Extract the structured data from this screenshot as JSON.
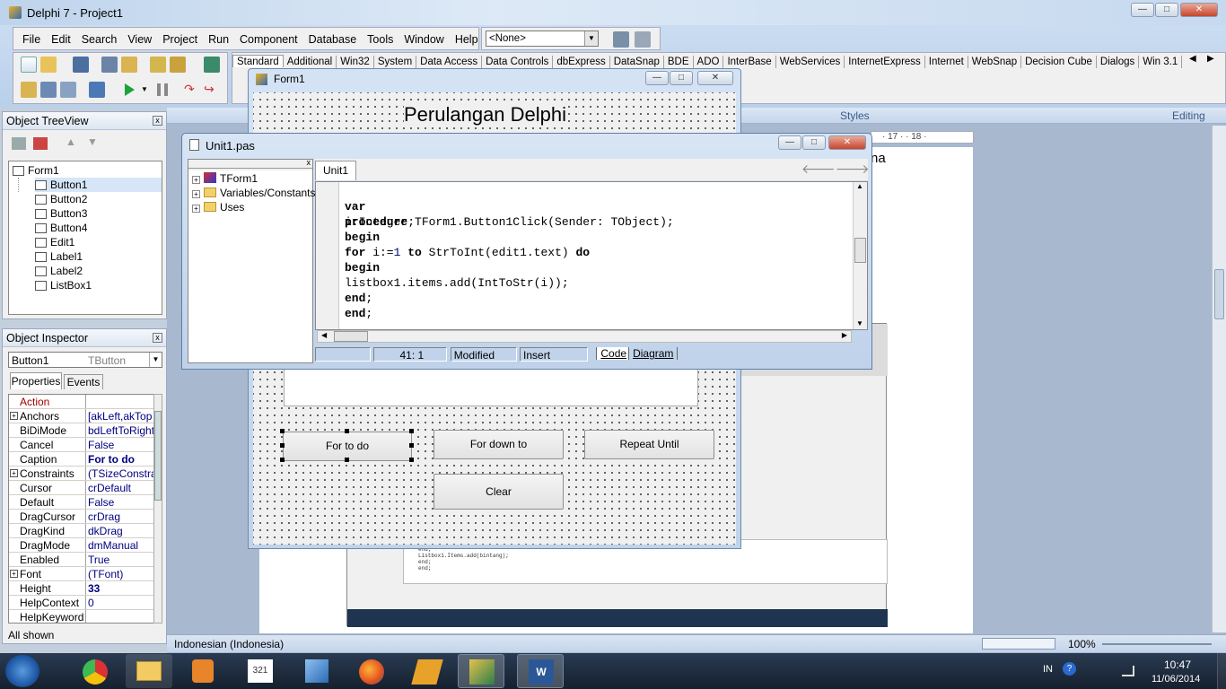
{
  "app": {
    "title": "Delphi 7 - Project1"
  },
  "menu": [
    "File",
    "Edit",
    "Search",
    "View",
    "Project",
    "Run",
    "Component",
    "Database",
    "Tools",
    "Window",
    "Help"
  ],
  "desktop_combo": "<None>",
  "palette_tabs": [
    "Standard",
    "Additional",
    "Win32",
    "System",
    "Data Access",
    "Data Controls",
    "dbExpress",
    "DataSnap",
    "BDE",
    "ADO",
    "InterBase",
    "WebServices",
    "InternetExpress",
    "Internet",
    "WebSnap",
    "Decision Cube",
    "Dialogs",
    "Win 3.1"
  ],
  "treeview": {
    "title": "Object TreeView",
    "root": "Form1",
    "items": [
      "Button1",
      "Button2",
      "Button3",
      "Button4",
      "Edit1",
      "Label1",
      "Label2",
      "ListBox1"
    ]
  },
  "inspector": {
    "title": "Object Inspector",
    "object": "Button1",
    "object_type": "TButton",
    "tabs": [
      "Properties",
      "Events"
    ],
    "footer": "All shown",
    "rows": [
      {
        "k": "Action",
        "v": "",
        "expand": false,
        "red": true
      },
      {
        "k": "Anchors",
        "v": "[akLeft,akTop",
        "expand": true
      },
      {
        "k": "BiDiMode",
        "v": "bdLeftToRight",
        "expand": false
      },
      {
        "k": "Cancel",
        "v": "False",
        "expand": false
      },
      {
        "k": "Caption",
        "v": "For to do",
        "expand": false,
        "bold": true
      },
      {
        "k": "Constraints",
        "v": "(TSizeConstra",
        "expand": true
      },
      {
        "k": "Cursor",
        "v": "crDefault",
        "expand": false
      },
      {
        "k": "Default",
        "v": "False",
        "expand": false
      },
      {
        "k": "DragCursor",
        "v": "crDrag",
        "expand": false
      },
      {
        "k": "DragKind",
        "v": "dkDrag",
        "expand": false
      },
      {
        "k": "DragMode",
        "v": "dmManual",
        "expand": false
      },
      {
        "k": "Enabled",
        "v": "True",
        "expand": false
      },
      {
        "k": "Font",
        "v": "(TFont)",
        "expand": true
      },
      {
        "k": "Height",
        "v": "33",
        "expand": false,
        "bold": true
      },
      {
        "k": "HelpContext",
        "v": "0",
        "expand": false
      },
      {
        "k": "HelpKeyword",
        "v": "",
        "expand": false
      }
    ]
  },
  "form": {
    "title": "Form1",
    "heading": "Perulangan Delphi",
    "buttons": {
      "for_to_do": "For to do",
      "for_down_to": "For down to",
      "repeat_until": "Repeat Until",
      "clear": "Clear"
    }
  },
  "editor": {
    "title": "Unit1.pas",
    "tab": "Unit1",
    "explorer": [
      "TForm1",
      "Variables/Constants",
      "Uses"
    ],
    "code": [
      "procedure TForm1.Button1Click(Sender: TObject);",
      "var",
      "i:Integer;",
      "begin",
      "for i:=1 to StrToInt(edit1.text) do",
      "begin",
      "listbox1.items.add(IntToStr(i));",
      "end;",
      "end;"
    ],
    "status": {
      "pos": "41:  1",
      "modified": "Modified",
      "mode": "Insert",
      "tab_code": "Code",
      "tab_diagram": "Diagram"
    }
  },
  "word": {
    "styles": "Styles",
    "editing": "Editing",
    "ruler": "· 17 · · 18 ·",
    "frag": "na",
    "language": "Indonesian (Indonesia)",
    "zoom": "100%"
  },
  "tray": {
    "lang": "IN",
    "time": "10:47",
    "date": "11/06/2014"
  },
  "colors": {
    "accent": "#3a6ea5",
    "taskbar": "#1c2a3a"
  }
}
